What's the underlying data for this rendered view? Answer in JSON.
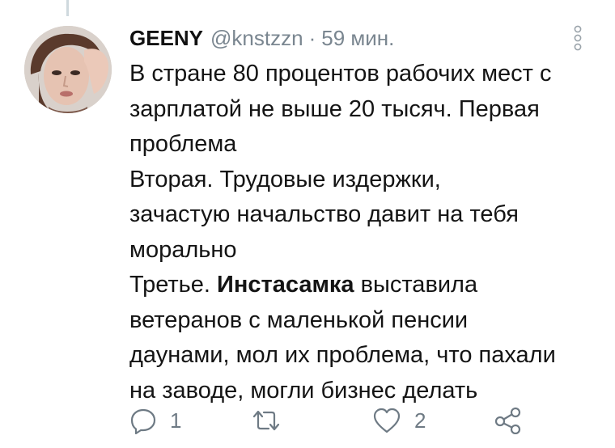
{
  "tweet": {
    "author_name": "GEENY",
    "author_handle": "@knstzzn",
    "separator": "·",
    "time": "59 мин.",
    "lines": [
      {
        "text": "В стране 80 процентов рабочих мест с"
      },
      {
        "text": "зарплатой не выше 20 тысяч. Первая"
      },
      {
        "text": "проблема"
      },
      {
        "text": "Вторая. Трудовые издержки,"
      },
      {
        "text": "зачастую начальство давит на тебя"
      },
      {
        "text": "морально"
      },
      {
        "pre": "Третье. ",
        "bold": "Инстасамка",
        "post": " выставила"
      },
      {
        "text": "ветеранов с маленькой пенсии"
      },
      {
        "text": "даунами, мол их проблема, что пахали"
      },
      {
        "text": "на заводе, могли бизнес делать"
      }
    ]
  },
  "actions": {
    "reply": {
      "icon": "reply-icon",
      "count": "1"
    },
    "retweet": {
      "icon": "retweet-icon",
      "count": ""
    },
    "like": {
      "icon": "heart-icon",
      "count": "2"
    },
    "share": {
      "icon": "share-icon",
      "count": ""
    }
  },
  "colors": {
    "text": "#141414",
    "muted": "#7a8690",
    "icon": "#6e7a84",
    "thread_line": "#cfd9de",
    "background": "#ffffff"
  }
}
